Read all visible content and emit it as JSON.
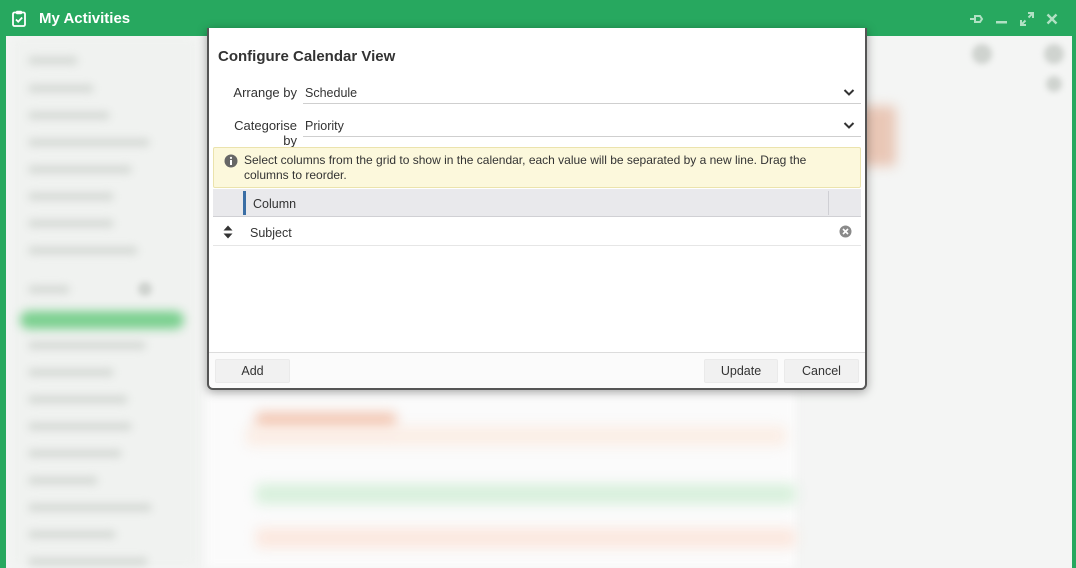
{
  "window": {
    "title": "My Activities",
    "icons": [
      "clipboard-icon",
      "pin-icon",
      "minimize-icon",
      "maximize-icon",
      "close-icon"
    ],
    "accent_color": "#27a85f"
  },
  "dialog": {
    "title": "Configure Calendar View",
    "arrange_by": {
      "label": "Arrange by",
      "value": "Schedule"
    },
    "categorise_by": {
      "label": "Categorise by",
      "value": "Priority"
    },
    "info_message": "Select columns from the grid to show in the calendar, each value will be separated by a new line. Drag the columns to reorder.",
    "grid": {
      "header": "Column",
      "rows": [
        {
          "value": "Subject"
        }
      ]
    },
    "buttons": {
      "add": "Add",
      "update": "Update",
      "cancel": "Cancel"
    }
  }
}
